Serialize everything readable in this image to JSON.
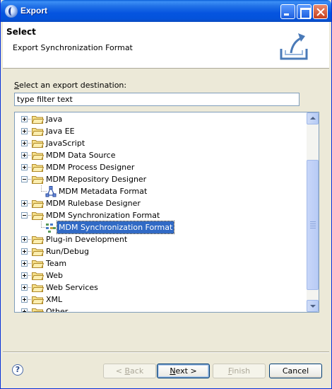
{
  "window": {
    "title": "Export"
  },
  "banner": {
    "title": "Select",
    "description": "Export Synchronization Format"
  },
  "destination": {
    "label_mnemonic": "S",
    "label_rest": "elect an export destination:"
  },
  "filter": {
    "value": "type filter text"
  },
  "tree": {
    "items": [
      {
        "label": "Java",
        "expanded": false,
        "level": 0
      },
      {
        "label": "Java EE",
        "expanded": false,
        "level": 0
      },
      {
        "label": "JavaScript",
        "expanded": false,
        "level": 0
      },
      {
        "label": "MDM Data Source",
        "expanded": false,
        "level": 0
      },
      {
        "label": "MDM Process Designer",
        "expanded": false,
        "level": 0
      },
      {
        "label": "MDM Repository Designer",
        "expanded": true,
        "level": 0
      },
      {
        "label": "MDM Metadata Format",
        "level": 1,
        "icon": "metadata-format-icon"
      },
      {
        "label": "MDM Rulebase Designer",
        "expanded": false,
        "level": 0
      },
      {
        "label": "MDM Synchronization Format",
        "expanded": true,
        "level": 0
      },
      {
        "label": "MDM Synchronization Format",
        "level": 1,
        "icon": "synchronization-format-icon",
        "selected": true
      },
      {
        "label": "Plug-in Development",
        "expanded": false,
        "level": 0
      },
      {
        "label": "Run/Debug",
        "expanded": false,
        "level": 0
      },
      {
        "label": "Team",
        "expanded": false,
        "level": 0
      },
      {
        "label": "Web",
        "expanded": false,
        "level": 0
      },
      {
        "label": "Web Services",
        "expanded": false,
        "level": 0
      },
      {
        "label": "XML",
        "expanded": false,
        "level": 0
      },
      {
        "label": "Other",
        "expanded": false,
        "level": 0
      }
    ]
  },
  "buttons": {
    "back": {
      "mnemonic": "B",
      "before": "< ",
      "after": "ack"
    },
    "next": {
      "mnemonic": "N",
      "before": "",
      "after": "ext >"
    },
    "finish": {
      "mnemonic": "F",
      "before": "",
      "after": "inish"
    },
    "cancel": {
      "label": "Cancel"
    }
  },
  "help": {
    "glyph": "?"
  },
  "colors": {
    "selection": "#316ac5",
    "titlebar": "#0554e0",
    "window_bg": "#ece9d8"
  }
}
